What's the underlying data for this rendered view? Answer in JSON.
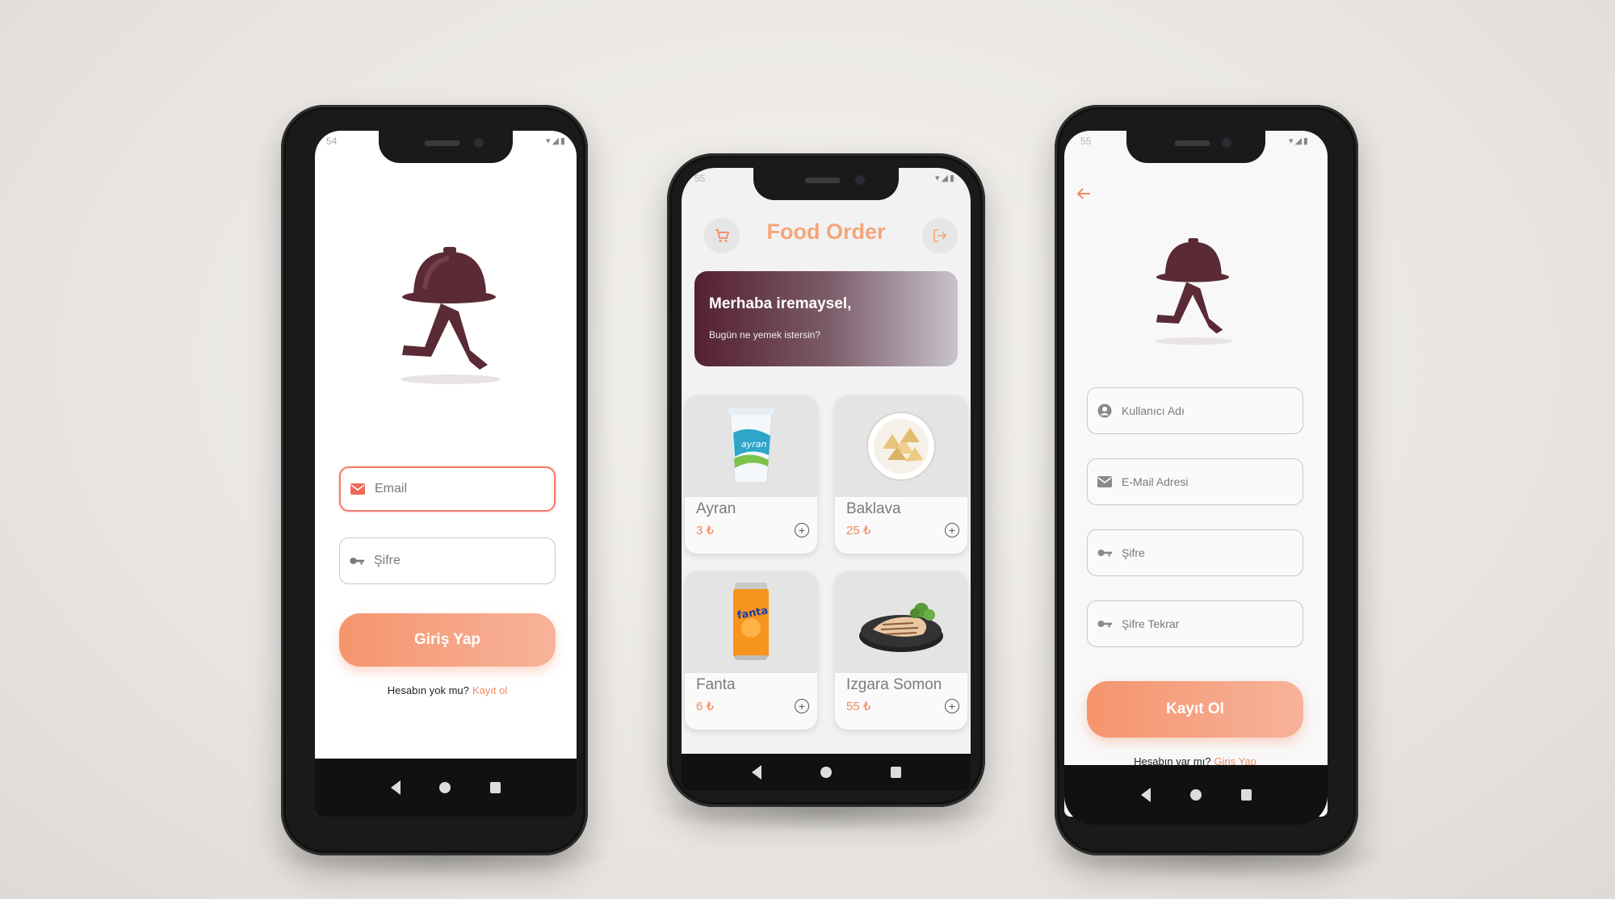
{
  "colors": {
    "accent": "#f28a62",
    "brand_dark": "#5a2a35",
    "card_bg": "#e4e4e4"
  },
  "login": {
    "status_time": "54",
    "email_placeholder": "Email",
    "password_placeholder": "Şifre",
    "submit_label": "Giriş Yap",
    "footer_text": "Hesabın yok mu?",
    "footer_link": "Kayıt ol",
    "icons": [
      "mail-icon",
      "key-icon"
    ]
  },
  "home": {
    "status_time": "55",
    "title": "Food Order",
    "greeting": "Merhaba iremaysel,",
    "subtitle": "Bugün ne yemek istersin?",
    "products": [
      {
        "name": "Ayran",
        "price": "3 ₺",
        "image": "ayran-cup"
      },
      {
        "name": "Baklava",
        "price": "25 ₺",
        "image": "baklava-plate"
      },
      {
        "name": "Fanta",
        "price": "6 ₺",
        "image": "fanta-can"
      },
      {
        "name": "Izgara Somon",
        "price": "55 ₺",
        "image": "grilled-salmon"
      }
    ],
    "icons": [
      "cart-icon",
      "logout-icon",
      "plus-circle-icon"
    ]
  },
  "register": {
    "status_time": "55",
    "username_placeholder": "Kullanıcı Adı",
    "email_placeholder": "E-Mail Adresi",
    "password_placeholder": "Şifre",
    "password_repeat_placeholder": "Şifre Tekrar",
    "submit_label": "Kayıt Ol",
    "footer_text": "Hesabın var mı?",
    "footer_link": "Giriş Yap",
    "icons": [
      "back-arrow-icon",
      "person-icon",
      "mail-icon",
      "key-icon"
    ]
  }
}
